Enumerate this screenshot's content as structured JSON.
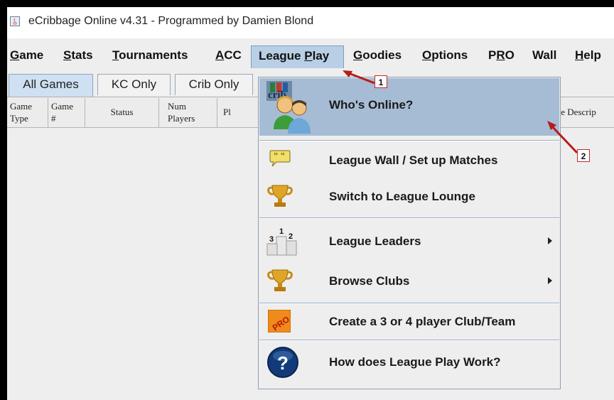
{
  "window": {
    "title": "eCribbage Online v4.31 - Programmed by Damien Blond",
    "icon": "java-app-icon"
  },
  "menubar": {
    "items": [
      {
        "pre": "",
        "mn": "G",
        "post": "ame"
      },
      {
        "pre": "",
        "mn": "S",
        "post": "tats"
      },
      {
        "pre": "",
        "mn": "T",
        "post": "ournaments"
      },
      {
        "pre": "",
        "mn": "A",
        "post": "CC"
      },
      {
        "pre": "League ",
        "mn": "P",
        "post": "lay"
      },
      {
        "pre": "",
        "mn": "G",
        "post": "oodies"
      },
      {
        "pre": "",
        "mn": "O",
        "post": "ptions"
      },
      {
        "pre": "P",
        "mn": "R",
        "post": "O"
      },
      {
        "pre": "Wall",
        "mn": "",
        "post": ""
      },
      {
        "pre": "",
        "mn": "H",
        "post": "elp"
      }
    ],
    "active_item": "League Play"
  },
  "tabs": [
    "All Games",
    "KC Only",
    "Crib Only"
  ],
  "selected_tab": "All Games",
  "table": {
    "columns": [
      {
        "line1": "Game",
        "line2": "Type"
      },
      {
        "line1": "Game",
        "line2": "#"
      },
      {
        "single": "Status"
      },
      {
        "line1": "Num",
        "line2": "Players"
      },
      {
        "single": "Pl"
      },
      {
        "single": "Game Descrip"
      }
    ]
  },
  "dropdown": {
    "items": [
      {
        "label": "Who's Online?",
        "icon": "players-online-icon",
        "highlighted": true
      },
      {
        "label": "League Wall / Set up Matches",
        "icon": "speech-bubble-icon"
      },
      {
        "label": "Switch to League Lounge",
        "icon": "trophy-icon"
      },
      {
        "label": "League Leaders",
        "icon": "podium-icon",
        "submenu": true
      },
      {
        "label": "Browse Clubs",
        "icon": "trophy-icon",
        "submenu": true
      },
      {
        "label": "Create a 3 or 4 player Club/Team",
        "icon": "pro-badge-icon"
      },
      {
        "label": "How does League Play Work?",
        "icon": "help-question-icon"
      }
    ],
    "icon_text": {
      "crib": "crib",
      "pro": "PRO",
      "podium": [
        "1",
        "2",
        "3"
      ],
      "help": "?"
    }
  },
  "annotations": [
    "1",
    "2"
  ],
  "colors": {
    "menu_highlight": "#a6bcd4",
    "active_menu": "#b8cfe5",
    "callout_border": "#c62828",
    "arrow": "#b71c1c"
  }
}
